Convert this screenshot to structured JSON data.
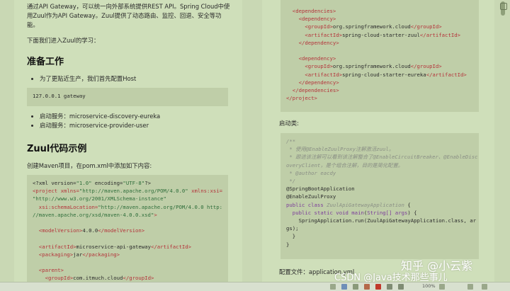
{
  "left": {
    "intro_line1": "通过API Gateway，可以统一向外部系统提供REST API。Spring Cloud中使",
    "intro_line2": "用Zuul作为API Gateway。Zuul提供了动态路由、监控、回退、安全等功",
    "intro_line3": "能。",
    "lead": "下面我们进入Zuul的学习：",
    "prep_heading": "准备工作",
    "prep_bullet": "为了更贴近生产，我们首先配置Host",
    "host_code": "127.0.0.1 gateway",
    "services": [
      "启动服务：microservice-discovery-eureka",
      "启动服务：microservice-provider-user"
    ],
    "example_heading": "Zuul代码示例",
    "example_intro": "创建Maven项目，在pom.xml中添加如下内容:"
  },
  "right": {
    "startup_label": "启动类:",
    "config_label": "配置文件：application.yml"
  },
  "watermark": {
    "zhihu": "知乎 @小云紫",
    "csdn": "CSDN @Java技术那些事儿"
  },
  "status": {
    "zoom": "100%"
  }
}
